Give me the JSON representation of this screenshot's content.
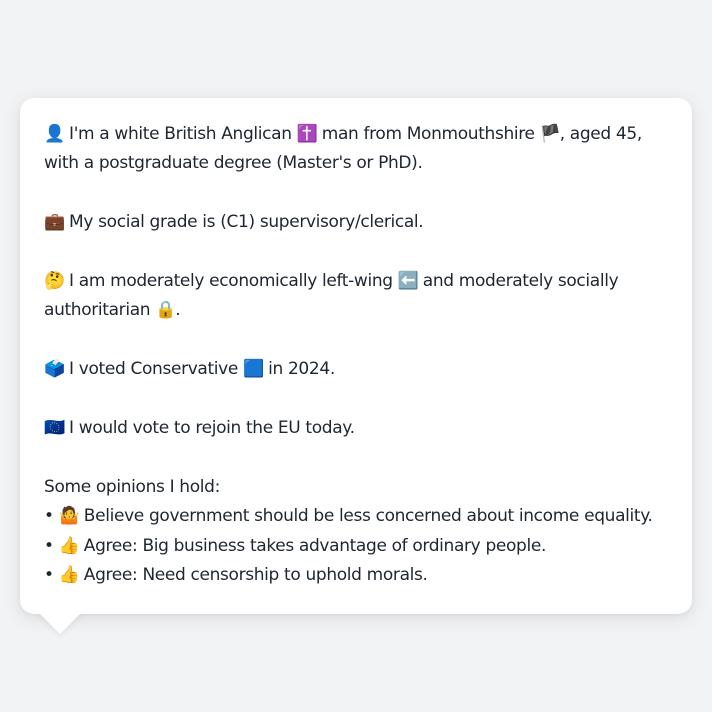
{
  "profile": {
    "identity": {
      "icon": "person-silhouette-icon",
      "emoji": "👤",
      "text_1": " I'm a white British Anglican ",
      "religion_emoji": "✝️",
      "text_2": " man from Monmouthshire ",
      "region_emoji": "🏴",
      "text_3": ", aged 45, with a postgraduate degree (Master's or PhD)."
    },
    "social_grade": {
      "icon": "briefcase-icon",
      "emoji": "💼",
      "text": " My social grade is (C1) supervisory/clerical."
    },
    "politics": {
      "icon": "thinking-face-icon",
      "emoji": "🤔",
      "text_1": " I am moderately economically left-wing ",
      "left_emoji": "⬅️",
      "text_2": " and moderately socially authoritarian ",
      "lock_emoji": "🔒",
      "text_3": "."
    },
    "vote": {
      "icon": "ballot-box-icon",
      "emoji": "🗳️",
      "text_1": " I voted Conservative ",
      "party_emoji": "🟦",
      "text_2": " in 2024."
    },
    "eu": {
      "icon": "eu-flag-icon",
      "emoji": "🇪🇺",
      "text": " I would vote to rejoin the EU today."
    },
    "opinions": {
      "heading": "Some opinions I hold:",
      "bullet": "•",
      "items": [
        {
          "emoji": "🤷",
          "icon": "shrug-icon",
          "text": " Believe government should be less concerned about income equality."
        },
        {
          "emoji": "👍",
          "icon": "thumbs-up-icon",
          "text": " Agree: Big business takes advantage of ordinary people."
        },
        {
          "emoji": "👍",
          "icon": "thumbs-up-icon",
          "text": " Agree: Need censorship to uphold morals."
        }
      ]
    }
  }
}
